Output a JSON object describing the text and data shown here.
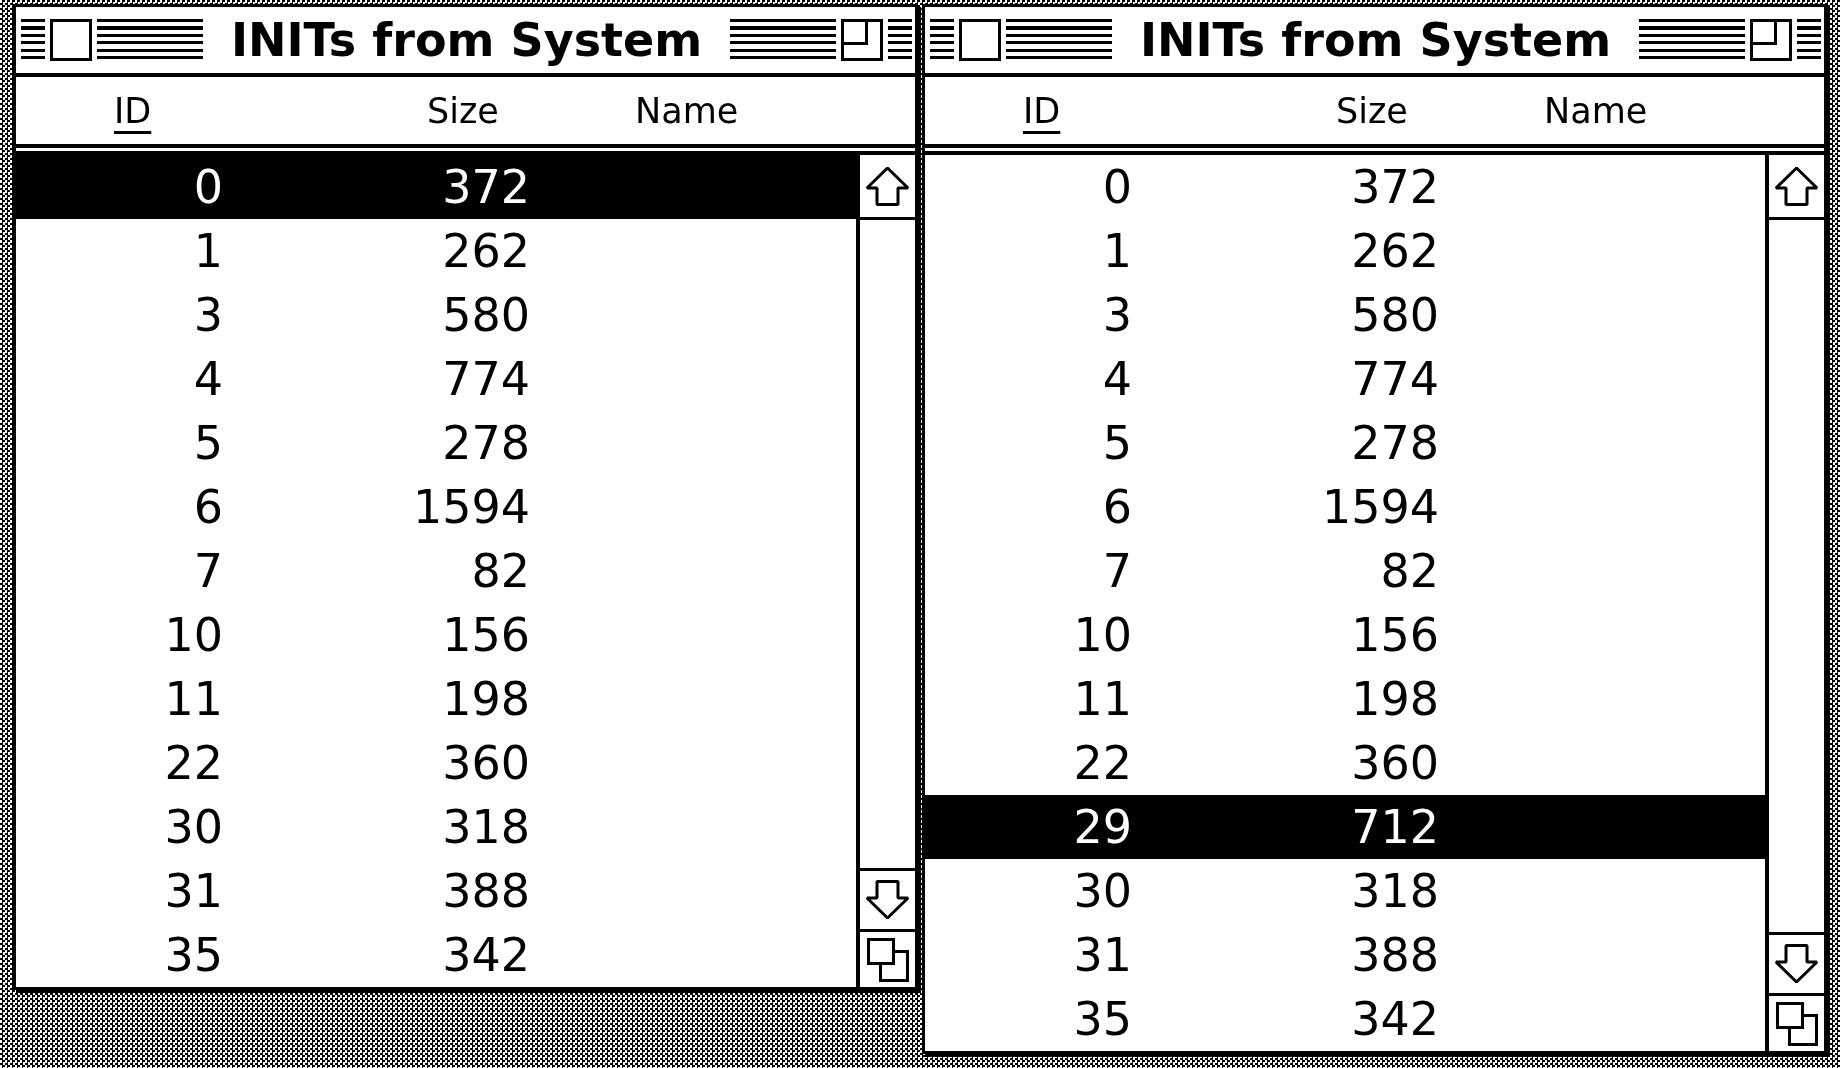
{
  "windows": [
    {
      "title": "INITs from System",
      "columns": [
        {
          "label": "ID",
          "sorted": true
        },
        {
          "label": "Size",
          "sorted": false
        },
        {
          "label": "Name",
          "sorted": false
        }
      ],
      "rows": [
        {
          "id": "0",
          "size": "372",
          "selected": true
        },
        {
          "id": "1",
          "size": "262",
          "selected": false
        },
        {
          "id": "3",
          "size": "580",
          "selected": false
        },
        {
          "id": "4",
          "size": "774",
          "selected": false
        },
        {
          "id": "5",
          "size": "278",
          "selected": false
        },
        {
          "id": "6",
          "size": "1594",
          "selected": false
        },
        {
          "id": "7",
          "size": "82",
          "selected": false
        },
        {
          "id": "10",
          "size": "156",
          "selected": false
        },
        {
          "id": "11",
          "size": "198",
          "selected": false
        },
        {
          "id": "22",
          "size": "360",
          "selected": false
        },
        {
          "id": "30",
          "size": "318",
          "selected": false
        },
        {
          "id": "31",
          "size": "388",
          "selected": false
        },
        {
          "id": "35",
          "size": "342",
          "selected": false
        }
      ]
    },
    {
      "title": "INITs from System",
      "columns": [
        {
          "label": "ID",
          "sorted": true
        },
        {
          "label": "Size",
          "sorted": false
        },
        {
          "label": "Name",
          "sorted": false
        }
      ],
      "rows": [
        {
          "id": "0",
          "size": "372",
          "selected": false
        },
        {
          "id": "1",
          "size": "262",
          "selected": false
        },
        {
          "id": "3",
          "size": "580",
          "selected": false
        },
        {
          "id": "4",
          "size": "774",
          "selected": false
        },
        {
          "id": "5",
          "size": "278",
          "selected": false
        },
        {
          "id": "6",
          "size": "1594",
          "selected": false
        },
        {
          "id": "7",
          "size": "82",
          "selected": false
        },
        {
          "id": "10",
          "size": "156",
          "selected": false
        },
        {
          "id": "11",
          "size": "198",
          "selected": false
        },
        {
          "id": "22",
          "size": "360",
          "selected": false
        },
        {
          "id": "29",
          "size": "712",
          "selected": true
        },
        {
          "id": "30",
          "size": "318",
          "selected": false
        },
        {
          "id": "31",
          "size": "388",
          "selected": false
        },
        {
          "id": "35",
          "size": "342",
          "selected": false
        }
      ]
    }
  ]
}
